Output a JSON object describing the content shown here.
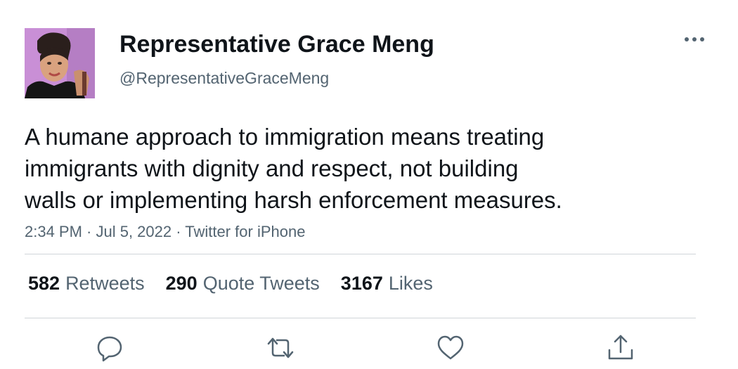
{
  "author": {
    "display_name": "Representative Grace Meng",
    "handle": "@RepresentativeGraceMeng"
  },
  "tweet": {
    "lines": [
      "A humane approach to immigration means treating",
      "immigrants with dignity and respect, not building",
      "walls or implementing harsh enforcement measures."
    ],
    "meta": "2:34 PM · Jul 5, 2022 · Twitter for iPhone"
  },
  "stats": {
    "retweets": {
      "count": "582",
      "label": "Retweets"
    },
    "quotes": {
      "count": "290",
      "label": "Quote Tweets"
    },
    "likes": {
      "count": "3167",
      "label": "Likes"
    }
  },
  "icons": {
    "more": "more-horizontal-icon",
    "reply": "reply-icon",
    "retweet": "retweet-icon",
    "like": "heart-icon",
    "share": "share-icon"
  },
  "colors": {
    "text_primary": "#0f1419",
    "text_secondary": "#536471",
    "divider": "#d0d5d9",
    "avatar_background": "#c98fd6"
  }
}
